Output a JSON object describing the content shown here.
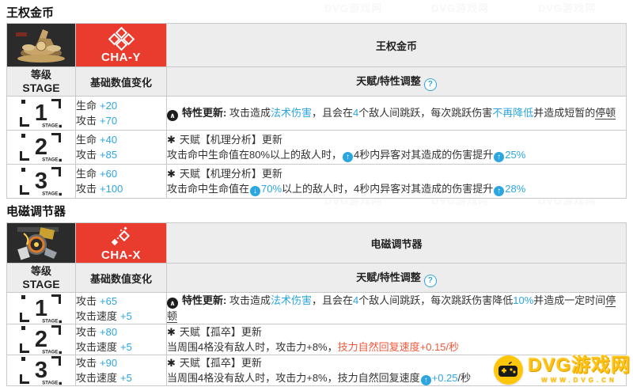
{
  "colors": {
    "red": "#e93b2e",
    "blue": "#2ca6e0",
    "orange": "#f0583a",
    "header_bg": "#ededed",
    "dark_cell": "#2b2b2b",
    "watermark_yellow": "#ffc60a"
  },
  "help_icon": "?",
  "watermark": {
    "brand": "DVG游戏网",
    "url": "WWW.DVG.CN"
  },
  "tables": [
    {
      "section_title": "王权金币",
      "module_code": "CHA-Y",
      "module_name": "王权金币",
      "headers": {
        "stage_cn": "等级",
        "stage_en": "STAGE",
        "stats": "基础数值变化",
        "talent": "天赋/特性调整"
      },
      "rows": [
        {
          "stage": "1",
          "stage_word": "STAGE",
          "stats": [
            {
              "label": "生命",
              "value": "+20"
            },
            {
              "label": "攻击",
              "value": "+70"
            }
          ],
          "lines": [
            [
              {
                "ic": "black-up"
              },
              {
                "t": "特性更新:",
                "b": true
              },
              {
                "t": " 攻击造成"
              },
              {
                "t": "法术伤害",
                "c": "blue"
              },
              {
                "t": "，且会在"
              },
              {
                "t": "4",
                "c": "blue"
              },
              {
                "t": "个敌人间跳跃，每次跳跃伤害"
              },
              {
                "t": "不再降低",
                "c": "blue"
              },
              {
                "t": "并造成短暂的"
              },
              {
                "t": "停顿",
                "u": true
              }
            ]
          ]
        },
        {
          "stage": "2",
          "stage_word": "STAGE",
          "stats": [
            {
              "label": "生命",
              "value": "+40"
            },
            {
              "label": "攻击",
              "value": "+85"
            }
          ],
          "lines": [
            [
              {
                "ic": "star"
              },
              {
                "t": "天赋【机理分析】更新"
              }
            ],
            [
              {
                "t": "攻击命中生命值在80%以上的敌人时，"
              },
              {
                "ic": "up"
              },
              {
                "t": "4秒内异客对其造成的伤害提升"
              },
              {
                "ic": "up"
              },
              {
                "t": "25%",
                "c": "blue"
              }
            ]
          ]
        },
        {
          "stage": "3",
          "stage_word": "STAGE",
          "stats": [
            {
              "label": "生命",
              "value": "+60"
            },
            {
              "label": "攻击",
              "value": "+100"
            }
          ],
          "lines": [
            [
              {
                "ic": "star"
              },
              {
                "t": "天赋【机理分析】更新"
              }
            ],
            [
              {
                "t": "攻击命中生命值在"
              },
              {
                "ic": "down"
              },
              {
                "t": "70%",
                "c": "blue"
              },
              {
                "t": "以上的敌人时，4秒内异客对其造成的伤害提升"
              },
              {
                "ic": "up"
              },
              {
                "t": "28%",
                "c": "blue"
              }
            ]
          ]
        }
      ]
    },
    {
      "section_title": "电磁调节器",
      "module_code": "CHA-X",
      "module_name": "电磁调节器",
      "headers": {
        "stage_cn": "等级",
        "stage_en": "STAGE",
        "stats": "基础数值变化",
        "talent": "天赋/特性调整"
      },
      "rows": [
        {
          "stage": "1",
          "stage_word": "STAGE",
          "stats": [
            {
              "label": "攻击",
              "value": "+65"
            },
            {
              "label": "攻击速度",
              "value": "+5"
            }
          ],
          "lines": [
            [
              {
                "ic": "black-up"
              },
              {
                "t": "特性更新:",
                "b": true
              },
              {
                "t": " 攻击造成"
              },
              {
                "t": "法术伤害",
                "c": "blue"
              },
              {
                "t": "，且会在"
              },
              {
                "t": "4",
                "c": "blue"
              },
              {
                "t": "个敌人间跳跃，每次跳跃伤害降低"
              },
              {
                "t": "10%",
                "c": "blue"
              },
              {
                "t": "并造成一定时间"
              },
              {
                "t": "停顿",
                "u": true
              }
            ]
          ]
        },
        {
          "stage": "2",
          "stage_word": "STAGE",
          "stats": [
            {
              "label": "攻击",
              "value": "+80"
            },
            {
              "label": "攻击速度",
              "value": "+5"
            }
          ],
          "lines": [
            [
              {
                "ic": "star"
              },
              {
                "t": "天赋【孤卒】更新"
              }
            ],
            [
              {
                "t": "当周围4格没有敌人时，攻击力+8%，"
              },
              {
                "t": "技力自然回复速度+0.15/秒",
                "c": "orange"
              }
            ]
          ]
        },
        {
          "stage": "3",
          "stage_word": "STAGE",
          "stats": [
            {
              "label": "攻击",
              "value": "+90"
            },
            {
              "label": "攻击速度",
              "value": "+5"
            }
          ],
          "lines": [
            [
              {
                "ic": "star"
              },
              {
                "t": "天赋【孤卒】更新"
              }
            ],
            [
              {
                "t": "当周围4格没有敌人时，攻击力+8%，技力自然回复速度"
              },
              {
                "ic": "up"
              },
              {
                "t": "+0.25",
                "c": "blue"
              },
              {
                "t": "/秒"
              }
            ]
          ]
        }
      ]
    }
  ]
}
